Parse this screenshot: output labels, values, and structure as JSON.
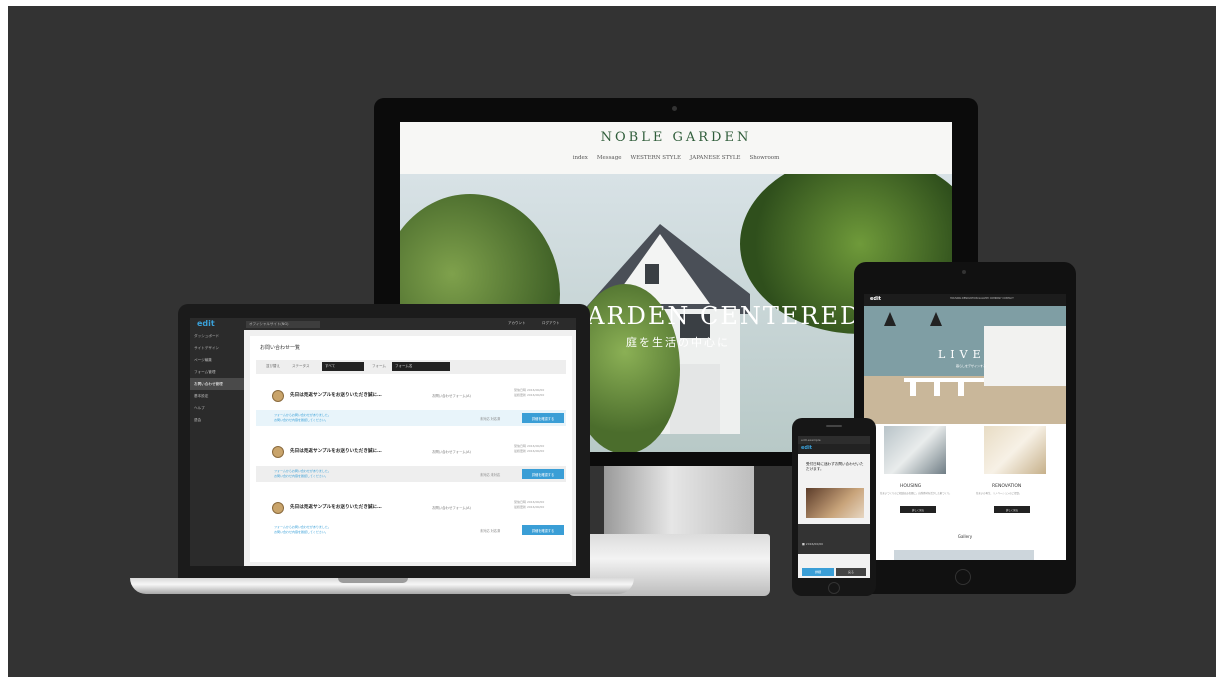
{
  "desktop": {
    "logo": "NOBLE GARDEN",
    "nav": [
      "index",
      "Message",
      "WESTERN STYLE",
      "JAPANESE STYLE",
      "Showroom"
    ],
    "hero_title": "GARDEN CENTERED LIFE",
    "hero_subtitle": "庭を生活の中心に"
  },
  "laptop": {
    "brand": "edit",
    "site_selector": "オフィシャルサイト(NG)",
    "user_label": "アカウント",
    "logout_label": "ログアウト",
    "sidebar": [
      "ダッシュボード",
      "サイトデザイン",
      "ページ編集",
      "フォーム管理",
      "お問い合わせ管理",
      "基本設定",
      "ヘルプ",
      "退会"
    ],
    "page_title": "お問い合わせ一覧",
    "filter": {
      "label1": "並び替え",
      "label2": "ステータス",
      "value1": "すべて",
      "label3": "フォーム",
      "value2": "フォーム名"
    },
    "messages": [
      {
        "title": "先日は見返サンプルをお送りいただき誠に…",
        "form": "お問い合わせフォーム(A)",
        "date1": "受信日時 2016/00/00",
        "date2": "最終更新 2016/00/00",
        "note1": "フォームからお問い合わせがありました。",
        "note2": "お問い合わせ内容を確認してください。",
        "status": "未対応 対応済",
        "button": "詳細を確認する"
      },
      {
        "title": "先日は見返サンプルをお送りいただき誠に…",
        "form": "お問い合わせフォーム(A)",
        "date1": "受信日時 2016/00/00",
        "date2": "最終更新 2016/00/00",
        "note1": "フォームからお問い合わせがありました。",
        "note2": "お問い合わせ内容を確認してください。",
        "status": "未対応 未対応",
        "button": "詳細を確認する"
      },
      {
        "title": "先日は見返サンプルをお送りいただき誠に…",
        "form": "お問い合わせフォーム(A)",
        "date1": "受信日時 2016/00/00",
        "date2": "最終更新 2016/00/00",
        "note1": "フォームからお問い合わせがありました。",
        "note2": "お問い合わせ内容を確認してください。",
        "status": "未対応 対応済",
        "button": "詳細を確認する"
      }
    ]
  },
  "tablet": {
    "logo": "edit",
    "nav": "HOUSING  RENOVATION  GALLERY  COMPANY  CONTACT",
    "hero_title": "LIVE",
    "hero_sub": "暮らしをデザインする",
    "sections": [
      {
        "title": "HOUSING",
        "text": "住まいづくりのご相談はお気軽に。自然素材を活かした家づくり。",
        "button": "詳しく見る"
      },
      {
        "title": "RENOVATION",
        "text": "住まいの再生、リノベーションのご提案。",
        "button": "詳しく見る"
      }
    ],
    "gallery": "Gallery"
  },
  "phone": {
    "url": "edit.example",
    "logo": "edit",
    "text": "受付日時に迷わずお問い合わせいただけます。",
    "caption": "■ 2016/00/00",
    "btn1": "詳細",
    "btn2": "戻る"
  }
}
